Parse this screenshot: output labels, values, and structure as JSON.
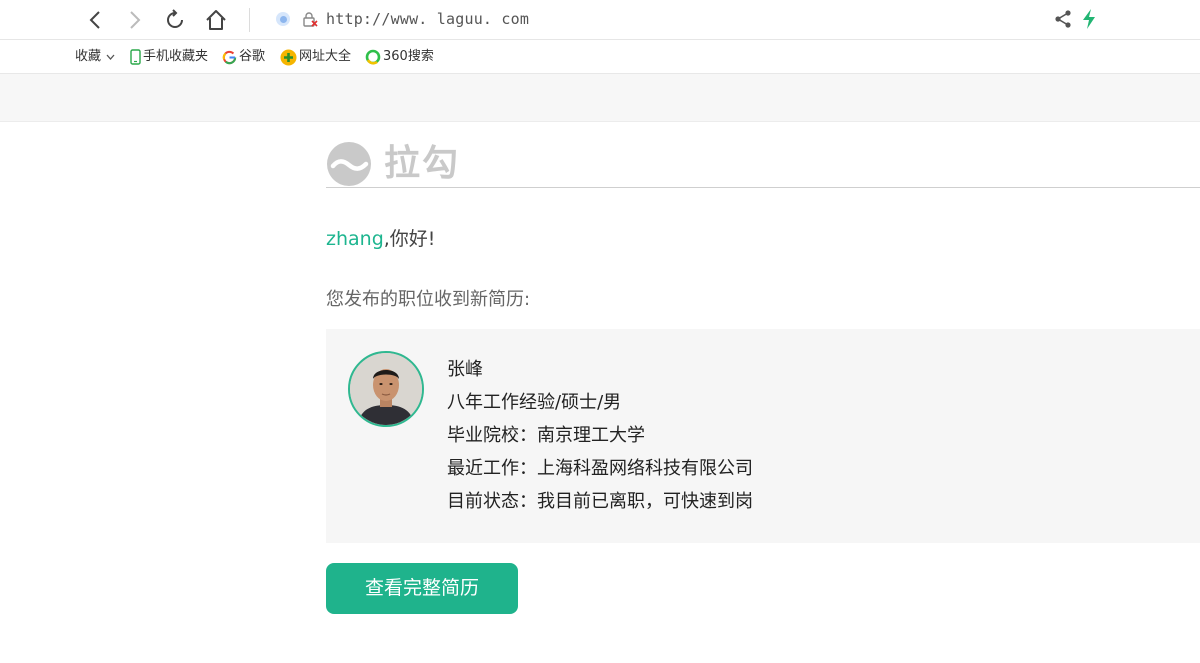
{
  "browser": {
    "url": "http://www. laguu. com",
    "bookmarks": [
      {
        "label": "收藏",
        "icon": "chevron-down-icon"
      },
      {
        "label": "手机收藏夹",
        "icon": "phone-icon"
      },
      {
        "label": "谷歌",
        "icon": "google-icon"
      },
      {
        "label": "网址大全",
        "icon": "plus-circle-icon"
      },
      {
        "label": "360搜索",
        "icon": "ring-icon"
      }
    ]
  },
  "email": {
    "logo_text": "拉勾",
    "greeting_name": "zhang",
    "greeting_text": ",你好!",
    "subtitle": "您发布的职位收到新简历:",
    "candidate": {
      "name": "张峰",
      "summary": "八年工作经验/硕士/男",
      "school": "毕业院校：南京理工大学",
      "recent_work": "最近工作：上海科盈网络科技有限公司",
      "status": "目前状态：我目前已离职，可快速到岗"
    },
    "cta_label": "查看完整简历"
  },
  "colors": {
    "accent": "#1fb38c",
    "logo_gray": "#c9c9c9",
    "card_bg": "#f6f6f6"
  }
}
